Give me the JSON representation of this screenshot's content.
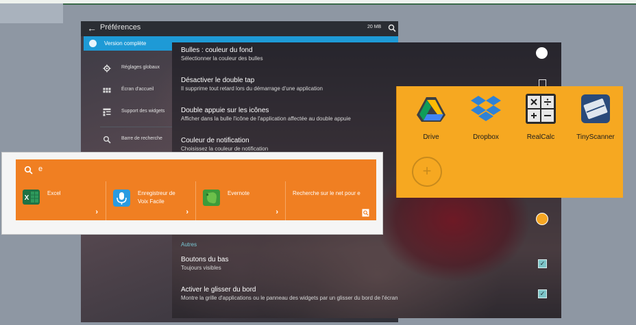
{
  "left_panel": {
    "title": "Préférences",
    "storage": "20 MB",
    "version_label": "Version complète",
    "menu": [
      {
        "label": "Réglages globaux",
        "icon": "gear-icon"
      },
      {
        "label": "Écran d'accueil",
        "icon": "grid-icon"
      },
      {
        "label": "Support des widgets",
        "icon": "widgets-icon"
      },
      {
        "label": "Barre de recherche",
        "icon": "search-icon"
      }
    ]
  },
  "right_panel": {
    "settings": [
      {
        "title": "Bulles : couleur du fond",
        "subtitle": "Sélectionner la couleur des bulles"
      },
      {
        "title": "Désactiver le double tap",
        "subtitle": "Il supprime tout retard lors du démarrage d'une application"
      },
      {
        "title": "Double appuie sur les icônes",
        "subtitle": "Afficher dans la bulle l'icône de l'application affectée au double appuie"
      },
      {
        "title": "Couleur de notification",
        "subtitle": "Choisissez la couleur de notification"
      }
    ],
    "section_label": "Autres",
    "bottom_settings": [
      {
        "title": "Boutons du bas",
        "subtitle": "Toujours visibles",
        "checked": true
      },
      {
        "title": "Activer le glisser du bord",
        "subtitle": "Montre la grille d'applications ou le panneau des widgets par un glisser du bord de l'écran",
        "checked": true
      }
    ],
    "colors": {
      "bubble": "#ffffff",
      "notification": "#f5a623"
    }
  },
  "search_overlay": {
    "query": "e",
    "accent": "#f07f22",
    "results": [
      {
        "label": "Excel",
        "icon": "excel-icon"
      },
      {
        "label": "Enregistreur de Voix Facile",
        "icon": "microphone-icon"
      },
      {
        "label": "Evernote",
        "icon": "evernote-icon"
      },
      {
        "label": "Recherche sur le net pour e",
        "icon": "web-search-icon"
      }
    ]
  },
  "apps_overlay": {
    "accent": "#f6a821",
    "apps": [
      {
        "label": "Drive",
        "icon": "drive-icon"
      },
      {
        "label": "Dropbox",
        "icon": "dropbox-icon"
      },
      {
        "label": "RealCalc",
        "icon": "calculator-icon"
      },
      {
        "label": "TinyScanner",
        "icon": "scanner-icon"
      }
    ],
    "add_icon": "plus-icon"
  }
}
